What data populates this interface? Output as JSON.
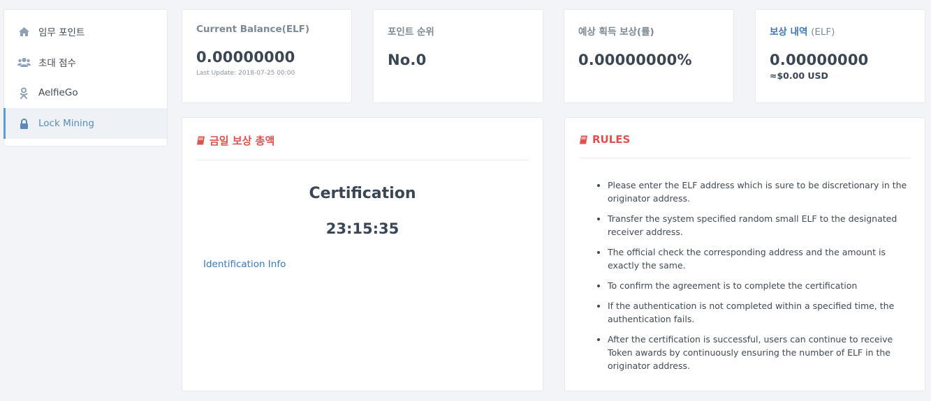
{
  "sidebar": {
    "items": [
      {
        "label": "임무 포인트",
        "icon": "home-icon"
      },
      {
        "label": "초대 점수",
        "icon": "users-icon"
      },
      {
        "label": "AelfieGo",
        "icon": "odnoklassniki-icon"
      },
      {
        "label": "Lock Mining",
        "icon": "lock-icon",
        "active": true
      }
    ]
  },
  "stats": {
    "balance": {
      "label": "Current Balance(ELF)",
      "value": "0.00000000",
      "note": "Last Update: 2018-07-25 00:00"
    },
    "rank": {
      "label": "포인트 순위",
      "value": "No.0"
    },
    "expected": {
      "label": "예상 획득 보상(률)",
      "value": "0.00000000%"
    },
    "reward": {
      "label": "보상 내역",
      "label_sub": "(ELF)",
      "value": "0.00000000",
      "usd": "≈$0.00 USD"
    }
  },
  "certification": {
    "panel_title": "금일 보상 총액",
    "title": "Certification",
    "timer": "23:15:35",
    "link": "Identification Info"
  },
  "rules": {
    "panel_title": "RULES",
    "items": [
      "Please enter the ELF address which is sure to be discretionary in the originator address.",
      "Transfer the system specified random small ELF to the designated receiver address.",
      "The official check the corresponding address and the amount is exactly the same.",
      "To confirm the agreement is to complete the certification",
      "If the authentication is not completed within a specified time, the authentication fails.",
      "After the certification is successful, users can continue to receive Token awards by continuously ensuring the number of ELF in the originator address."
    ]
  },
  "colors": {
    "accent": "#3b79b6",
    "danger": "#d9534f",
    "background": "#f3f4f7"
  }
}
